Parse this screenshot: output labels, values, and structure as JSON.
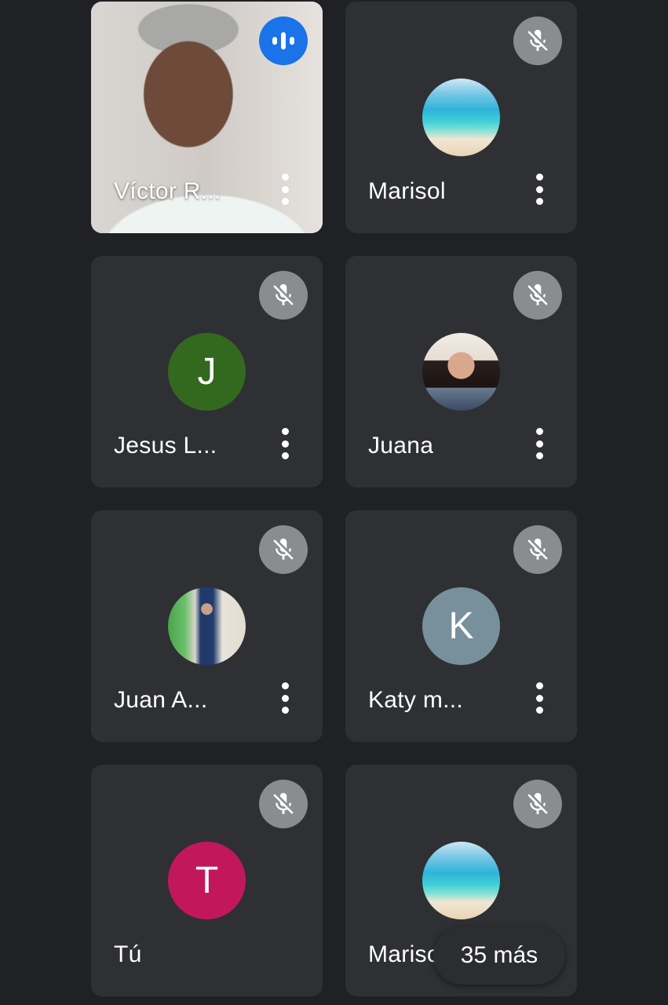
{
  "participants": [
    {
      "name": "Víctor R...",
      "avatar_letter": "",
      "avatar_color": "",
      "state": "speaking",
      "kind": "video"
    },
    {
      "name": "Marisol",
      "avatar_letter": "",
      "avatar_color": "",
      "state": "muted",
      "kind": "beach-photo"
    },
    {
      "name": "Jesus L...",
      "avatar_letter": "J",
      "avatar_color": "#33691e",
      "state": "muted",
      "kind": "letter"
    },
    {
      "name": "Juana",
      "avatar_letter": "",
      "avatar_color": "",
      "state": "muted",
      "kind": "photo"
    },
    {
      "name": "Juan A...",
      "avatar_letter": "",
      "avatar_color": "",
      "state": "muted",
      "kind": "photo"
    },
    {
      "name": "Katy m...",
      "avatar_letter": "K",
      "avatar_color": "#78909c",
      "state": "muted",
      "kind": "letter"
    },
    {
      "name": "Tú",
      "avatar_letter": "T",
      "avatar_color": "#c2185b",
      "state": "muted",
      "kind": "letter"
    },
    {
      "name": "Marisol",
      "avatar_letter": "",
      "avatar_color": "",
      "state": "muted",
      "kind": "beach-photo"
    }
  ],
  "more_participants_label": "35 más",
  "icons": {
    "muted": "mic-off-icon",
    "speaking": "audio-level-icon",
    "menu": "more-vert-icon"
  },
  "colors": {
    "background": "#202124",
    "tile": "#2f3033",
    "speaking_badge": "#1a73e8",
    "mute_badge": "#8a8c90"
  }
}
